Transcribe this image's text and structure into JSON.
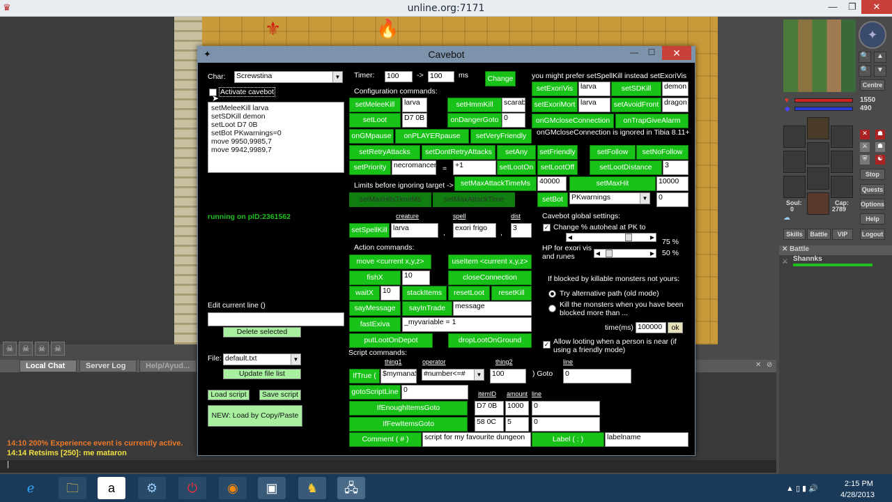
{
  "outer": {
    "title": "unline.org:7171",
    "min": "—",
    "max": "❐",
    "close": "✕"
  },
  "chat": {
    "tabs": [
      "Local Chat",
      "Server Log",
      "Help/Ayud..."
    ],
    "lines": [
      {
        "text": "14:10 200% Experience event is currently active.",
        "color": "#e8782a"
      },
      {
        "text": "14:14 Retsims [250]: me mataron",
        "color": "#f0e040"
      }
    ],
    "input_value": "|",
    "tab_x": "✕",
    "tab_o": "⊘"
  },
  "sidebar": {
    "compass": "✦",
    "hp_value": "1550",
    "mp_value": "490",
    "hp_fill": 1.0,
    "mp_fill": 1.0,
    "buttons_top": [
      "Centre"
    ],
    "soul_label": "Soul:",
    "soul_value": "0",
    "cap_label": "Cap:",
    "cap_value": "2789",
    "right_buttons": [
      "Stop",
      "Quests",
      "Options",
      "Help",
      "Logout"
    ],
    "bottom_buttons": [
      "Skills",
      "Battle",
      "VIP"
    ],
    "battle_title": "Battle",
    "battle_entries": [
      {
        "name": "Shannks",
        "hp_fill": 1.0
      }
    ]
  },
  "taskbar": {
    "time": "2:15 PM",
    "date": "4/28/2013"
  },
  "cavebot": {
    "title": "Cavebot",
    "min": "—",
    "max": "☐",
    "close": "✕",
    "char_label": "Char:",
    "char_value": "Screwstina",
    "activate_label": "Activate cavebot",
    "script_lines": [
      "setMeleeKill larva",
      "setSDKill demon",
      "setLoot D7 0B",
      "setBot PKwarnings=0",
      "move 9950,9985,7",
      "move 9942,9989,7"
    ],
    "running_text": "running on pID:2361562",
    "edit_label": "Edit current line ()",
    "edit_value": "",
    "delete_btn": "Delete selected",
    "file_label": "File:",
    "file_value": "default.txt",
    "update_btn": "Update file list",
    "load_btn": "Load script",
    "save_btn": "Save script",
    "new_btn": "NEW: Load by Copy/Paste",
    "timer_label": "Timer:",
    "timer_from": "100",
    "timer_arrow": "->",
    "timer_to": "100",
    "timer_unit": "ms",
    "change_btn": "Change",
    "config_label": "Configuration commands:",
    "prefer_text": "you might prefer setSpellKill instead setExoriVis",
    "btn_setMeleeKill": "setMeleeKill",
    "val_melee": "larva",
    "btn_setHmmKill": "setHmmKill",
    "val_hmm": "scarab",
    "btn_setLoot": "setLoot",
    "val_loot": "D7 0B",
    "btn_onDangerGoto": "onDangerGoto",
    "val_danger": "0",
    "btn_onGMpause": "onGMpause",
    "btn_onPLAYERpause": "onPLAYERpause",
    "btn_setVeryFriendly": "setVeryFriendly",
    "btn_setRetryAttacks": "setRetryAttacks",
    "btn_setDontRetryAttacks": "setDontRetryAttacks",
    "btn_setAny": "setAny",
    "btn_setFriendly": "setFriendly",
    "btn_setPriority": "setPriority",
    "val_priority": "necromancer",
    "eq": "=",
    "val_priority2": "+1",
    "btn_setLootOn": "setLootOn",
    "btn_setLootOff": "setLootOff",
    "limits_label": "Limits before ignoring target ->",
    "btn_setMaxAttackTimeMs": "setMaxAttackTimeMs",
    "val_maxattack": "40000",
    "btn_disabled1": "setMaxHitsTimeMs",
    "btn_disabled2": "setMaxAttackTime",
    "btn_setExoriVis": "setExoriVis",
    "val_exorivis": "larva",
    "btn_setSDKill": "setSDKill",
    "val_sdkill": "demon",
    "btn_setExoriMort": "setExoriMort",
    "val_exorimort": "larva",
    "btn_setAvoidFront": "setAvoidFront",
    "val_avoidfront": "dragon",
    "btn_onGMcloseConnection": "onGMcloseConnection",
    "btn_onTrapGiveAlarm": "onTrapGiveAlarm",
    "gm_note": "onGMcloseConnection is ignored in Tibia 8.11+",
    "btn_setFollow": "setFollow",
    "btn_setNoFollow": "setNoFollow",
    "btn_setLootDistance": "setLootDistance",
    "val_lootdist": "3",
    "btn_setMaxHit": "setMaxHit",
    "val_maxhit": "10000",
    "btn_setBot": "setBot",
    "val_setbot": "PKwarnings",
    "val_setbot2": "0",
    "col_creature": "creature",
    "col_spell": "spell",
    "col_dist": "dist",
    "btn_setSpellKill": "setSpellKill",
    "val_sk_creature": "larva",
    "val_sk_spell": "exori frigo",
    "val_sk_dist": "3",
    "comma": ",",
    "action_label": "Action commands:",
    "btn_move": "move <current x,y,z>",
    "btn_useItem": "useItem <current x,y,z>",
    "btn_fishX": "fishX",
    "val_fish": "10",
    "btn_closeConnection": "closeConnection",
    "btn_waitX": "waitX",
    "val_wait": "10",
    "btn_stackItems": "stackItems",
    "btn_resetLoot": "resetLoot",
    "btn_resetKill": "resetKill",
    "btn_sayMessage": "sayMessage",
    "btn_sayInTrade": "sayInTrade",
    "val_message": "message",
    "btn_fastExiva": "fastExiva",
    "val_variable": "_myvariable = 1",
    "btn_putLootOnDepot": "putLootOnDepot",
    "btn_dropLootOnGround": "dropLootOnGround",
    "script_label": "Script commands:",
    "col_thing1": "thing1",
    "col_operator": "operator",
    "col_thing2": "thing2",
    "col_line": "line",
    "btn_IfTrue": "IfTrue (",
    "val_thing1": "$mymana$",
    "val_operator": "#number<=#",
    "val_thing2": "100",
    "goto_label": ") Goto",
    "val_goto": "0",
    "btn_gotoScriptLine": "gotoScriptLine",
    "val_gotoline": "0",
    "col_itemID": "itemID",
    "col_amount": "amount",
    "col_line2": "line",
    "btn_IfEnoughItemsGoto": "IfEnoughItemsGoto",
    "val_enough_id": "D7 0B",
    "val_enough_amt": "1000",
    "val_enough_line": "0",
    "btn_IfFewItemsGoto": "IfFewItemsGoto",
    "val_few_id": "58 0C",
    "val_few_amt": "5",
    "val_few_line": "0",
    "btn_Comment": "Comment ( # )",
    "val_comment": "script for my favourite dungeon",
    "btn_Label": "Label ( : )",
    "val_label": "labelname",
    "global_label": "Cavebot global settings:",
    "change_autoheal": "Change % autoheal at PK to",
    "pct75": "75 %",
    "hp_exori": "HP for exori vis",
    "and_runes": "and runes",
    "pct50": "50 %",
    "slider1_fill": 0.75,
    "slider2_fill": 0.1,
    "blocked_label": "If blocked by killable monsters not yours:",
    "radio1": "Try alternative path (old mode)",
    "radio2": "Kill the monsters when you have been blocked more than ...",
    "time_label": "time(ms) :",
    "time_value": "100000",
    "ok_btn": "ok",
    "allow_loot": "Allow looting when a person is near (if using a friendly mode)"
  }
}
